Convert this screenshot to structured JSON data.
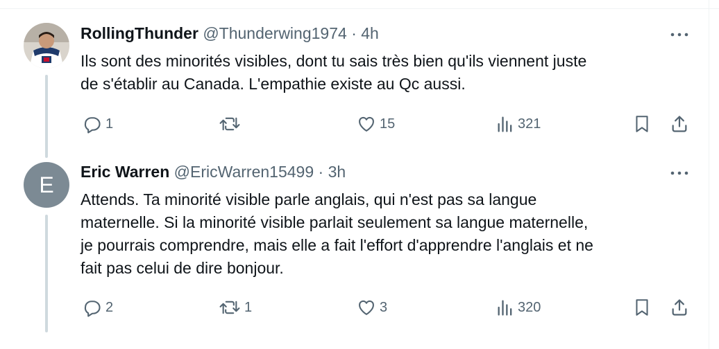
{
  "tweets": [
    {
      "display_name": "RollingThunder",
      "handle": "@Thunderwing1974",
      "time": "4h",
      "avatar_letter": "",
      "text_lines": [
        "Ils sont des minorités visibles, dont tu sais très bien qu'ils viennent juste",
        "de s'établir au Canada. L'empathie existe au Qc aussi."
      ],
      "replies": "1",
      "retweets": "",
      "likes": "15",
      "views": "321"
    },
    {
      "display_name": "Eric Warren",
      "handle": "@EricWarren15499",
      "time": "3h",
      "avatar_letter": "E",
      "text_lines": [
        "Attends.  Ta minorité visible parle anglais, qui n'est pas sa langue",
        "maternelle.   Si la minorité visible parlait seulement sa langue maternelle,",
        "je pourrais comprendre, mais elle a fait l'effort d'apprendre l'anglais et ne",
        "fait pas celui de dire bonjour."
      ],
      "replies": "2",
      "retweets": "1",
      "likes": "3",
      "views": "320"
    }
  ],
  "separator": "·",
  "icons": [
    "more-icon",
    "reply-icon",
    "retweet-icon",
    "like-icon",
    "views-icon",
    "bookmark-icon",
    "share-icon"
  ],
  "colors": {
    "text": "#0f1419",
    "muted": "#536471",
    "thread_line": "#cfd9de",
    "avatar_gray": "#7c8a94",
    "link": "#1d9bf0"
  }
}
